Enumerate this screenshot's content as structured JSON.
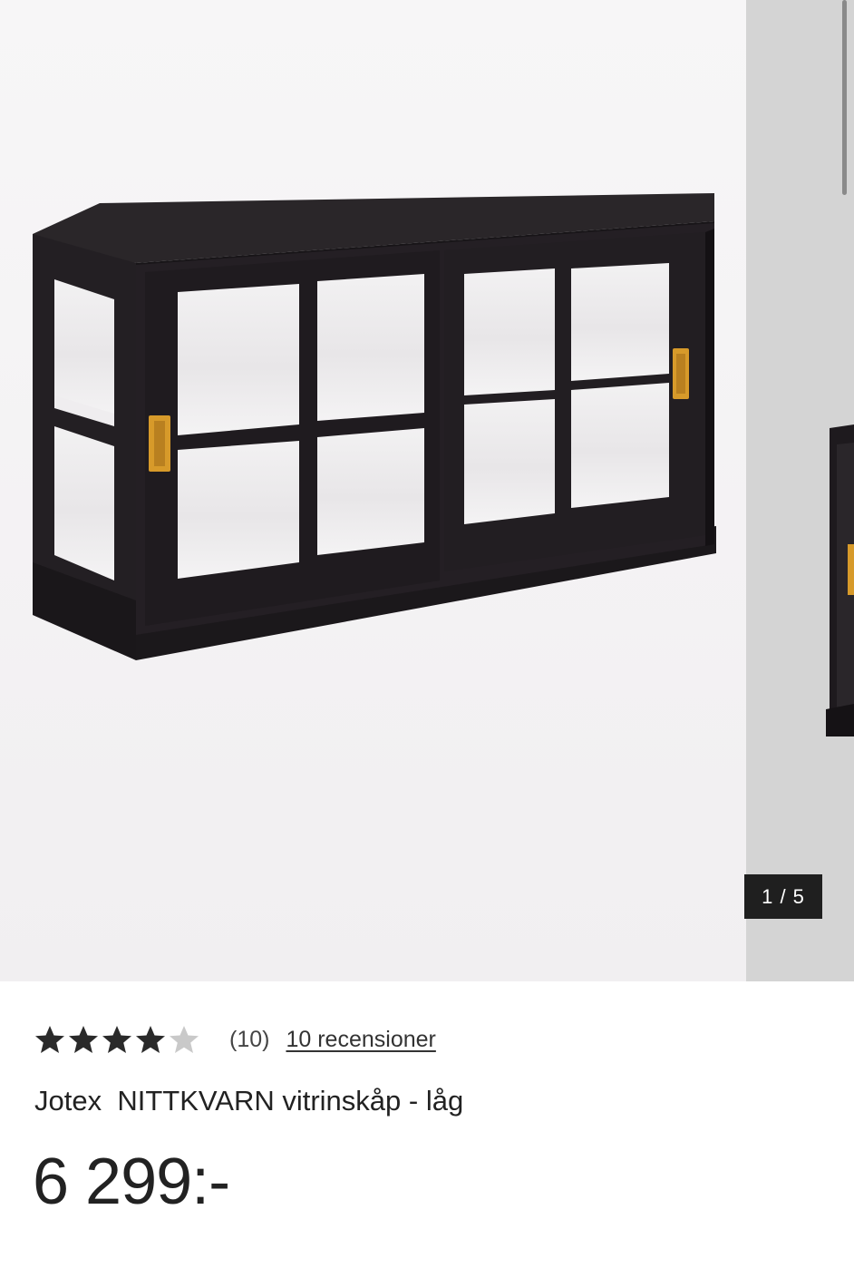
{
  "gallery": {
    "image_alt": "Jotex NITTKVARN vitrinskåp - låg",
    "counter": "1 / 5",
    "current": 1,
    "total": 5
  },
  "product": {
    "rating": 4,
    "rating_max": 5,
    "rating_count": "(10)",
    "reviews_link": "10 recensioner",
    "brand": "Jotex",
    "name": "NITTKVARN vitrinskåp - låg",
    "price": "6 299:-"
  },
  "colors": {
    "cabinet": "#1e1a1f",
    "handle": "#d79a2a",
    "star_filled": "#2a2a2a",
    "star_empty": "#c9c9c9"
  }
}
